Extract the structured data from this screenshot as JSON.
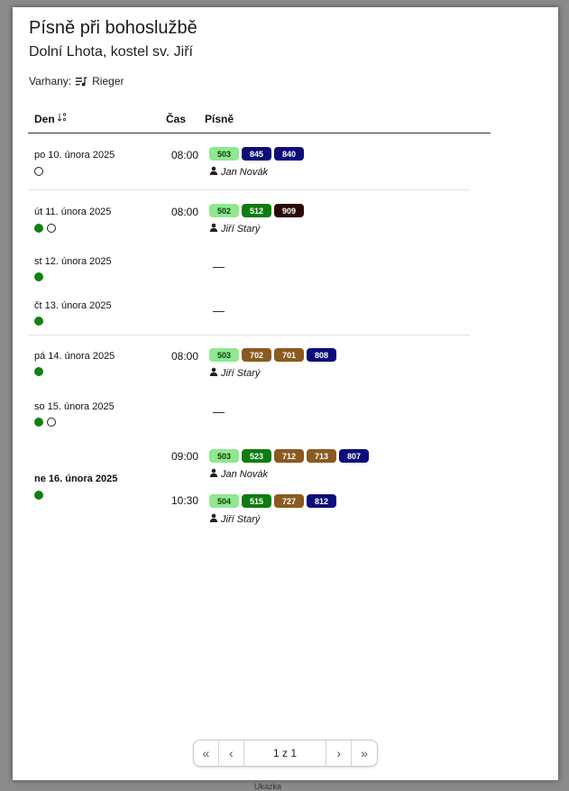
{
  "header": {
    "title": "Písně při bohoslužbě",
    "subtitle": "Dolní Lhota, kostel sv. Jiří",
    "organ_label": "Varhany:",
    "organ_name": "Rieger",
    "organ_icon": "music-list-icon"
  },
  "table": {
    "col_day": "Den",
    "col_time": "Čas",
    "col_songs": "Písně",
    "sort_icon": "sort-icon"
  },
  "colors": {
    "light": "#90e890",
    "green": "#0e7c10",
    "navy": "#0d0d7a",
    "brown": "#8a5a20",
    "dark": "#2a0a08",
    "dot": "#118011"
  },
  "days": [
    {
      "date": "po 10. února 2025",
      "dots": [
        "empty"
      ]
    },
    {
      "date": "út 11. února 2025",
      "dots": [
        "full",
        "empty"
      ]
    },
    {
      "date": "st 12. února 2025",
      "dots": [
        "full"
      ],
      "empty_mark": "—"
    },
    {
      "date": "čt 13. února 2025",
      "dots": [
        "full"
      ],
      "empty_mark": "—"
    },
    {
      "date": "pá 14. února 2025",
      "dots": [
        "full"
      ]
    },
    {
      "date": "so 15. února 2025",
      "dots": [
        "full",
        "empty"
      ],
      "empty_mark": "—"
    },
    {
      "date": "ne 16. února 2025",
      "dots": [
        "full"
      ]
    }
  ],
  "services": [
    {
      "time": "08:00",
      "songs": [
        "503",
        "845",
        "840"
      ],
      "person": "Jan Novák"
    },
    {
      "time": "08:00",
      "songs": [
        "502",
        "512",
        "909"
      ],
      "person": "Jiří Starý"
    },
    {
      "time": "08:00",
      "songs": [
        "503",
        "702",
        "701",
        "808"
      ],
      "person": "Jiří Starý"
    },
    {
      "time": "09:00",
      "songs": [
        "503",
        "523",
        "712",
        "713",
        "807"
      ],
      "person": "Jan Novák"
    },
    {
      "time": "10:30",
      "songs": [
        "504",
        "515",
        "727",
        "812"
      ],
      "person": "Jiří Starý"
    }
  ],
  "pager": {
    "info": "1 z 1",
    "first": "«",
    "prev": "‹",
    "next": "›",
    "last": "»"
  },
  "footer": {
    "text": "Ukázka"
  }
}
